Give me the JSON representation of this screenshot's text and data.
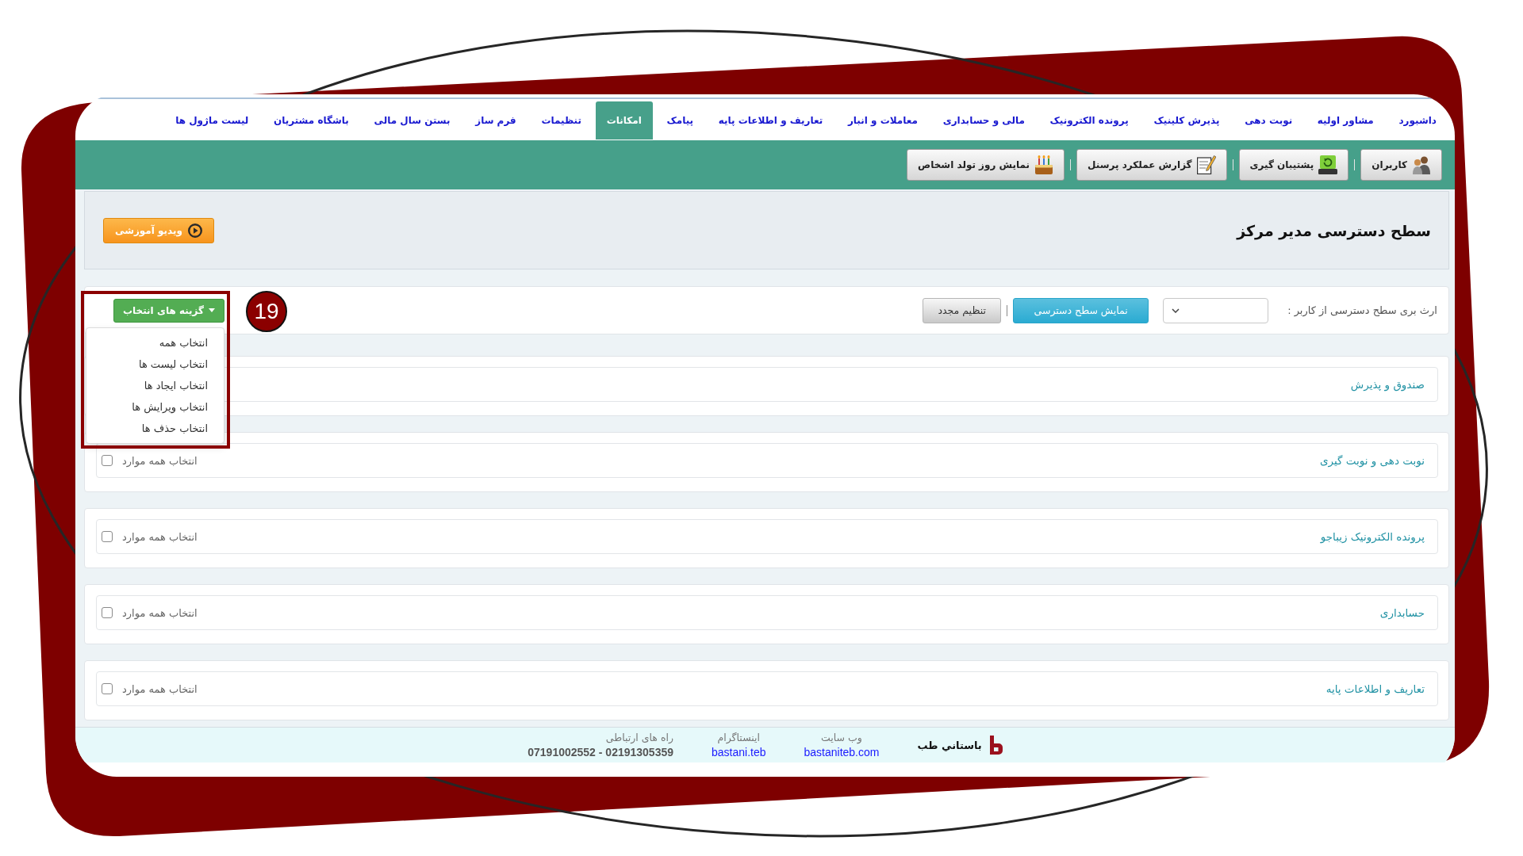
{
  "nav": {
    "items": [
      {
        "label": "داشبورد",
        "selected": false
      },
      {
        "label": "مشاور اولیه",
        "selected": false
      },
      {
        "label": "نوبت دهی",
        "selected": false
      },
      {
        "label": "پذیرش کلینیک",
        "selected": false
      },
      {
        "label": "پرونده الکترونیک",
        "selected": false
      },
      {
        "label": "مالی و حسابداری",
        "selected": false
      },
      {
        "label": "معاملات و انبار",
        "selected": false
      },
      {
        "label": "تعاریف و اطلاعات پایه",
        "selected": false
      },
      {
        "label": "پیامک",
        "selected": false
      },
      {
        "label": "امکانات",
        "selected": true
      },
      {
        "label": "تنظیمات",
        "selected": false
      },
      {
        "label": "فرم ساز",
        "selected": false
      },
      {
        "label": "بستن سال مالی",
        "selected": false
      },
      {
        "label": "باشگاه مشتریان",
        "selected": false
      },
      {
        "label": "لیست ماژول ها",
        "selected": false
      }
    ]
  },
  "toolbar": {
    "buttons": [
      {
        "label": "کاربران",
        "kind": "users"
      },
      {
        "label": "پشتیبان گیری",
        "kind": "backup"
      },
      {
        "label": "گزارش عملکرد پرسنل",
        "kind": "report"
      },
      {
        "label": "نمایش روز تولد اشخاص",
        "kind": "birthday"
      }
    ]
  },
  "header": {
    "title": "سطح دسترسی مدیر مرکز",
    "video_button": "ویدیو آموزشی"
  },
  "access": {
    "label": "ارث بری سطح دسترسی از کاربر :",
    "show_button": "نمایش سطح دسترسی",
    "reset_button": "تنظیم مجدد"
  },
  "options_dropdown": {
    "label": "گزینه های انتخاب",
    "expanded": true,
    "items": [
      "انتخاب همه",
      "انتخاب لیست ها",
      "انتخاب ایجاد ها",
      "انتخاب ویرایش ها",
      "انتخاب حذف ها"
    ]
  },
  "callout": {
    "number": "19"
  },
  "sections": [
    {
      "title": "صندوق و پذیرش"
    },
    {
      "title": "نوبت دهی و نوبت گیری",
      "select_all": {
        "label": "انتخاب همه موارد",
        "checked": false
      }
    },
    {
      "title": "پرونده الکترونیک زیباجو",
      "select_all": {
        "label": "انتخاب همه موارد",
        "checked": false
      }
    },
    {
      "title": "حسابداری",
      "select_all": {
        "label": "انتخاب همه موارد",
        "checked": false
      }
    },
    {
      "title": "تعاریف و اطلاعات پایه",
      "select_all": {
        "label": "انتخاب همه موارد",
        "checked": false
      }
    }
  ],
  "footer": {
    "brand": "باستاني طب",
    "columns": [
      {
        "label": "وب سایت",
        "value": "bastaniteb.com",
        "kind": "link"
      },
      {
        "label": "اینستاگرام",
        "value": "bastani.teb",
        "kind": "link"
      },
      {
        "label": "راه های ارتباطی",
        "value": "07191002552 - 02191305359",
        "kind": "phone"
      }
    ]
  }
}
